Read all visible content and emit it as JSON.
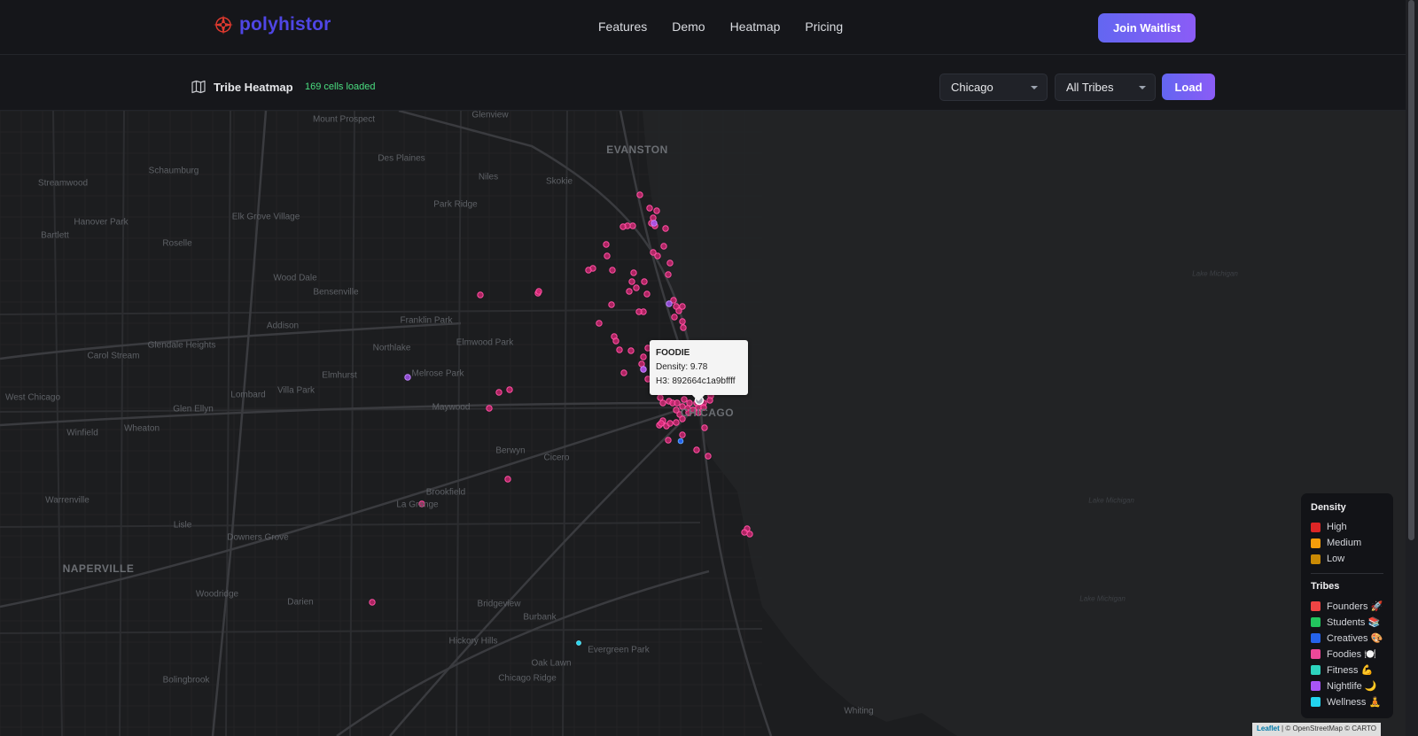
{
  "brand": {
    "name": "polyhistor"
  },
  "nav": {
    "links": [
      "Features",
      "Demo",
      "Heatmap",
      "Pricing"
    ],
    "cta": "Join Waitlist"
  },
  "toolbar": {
    "title": "Tribe Heatmap",
    "status": "169 cells loaded",
    "city_select": "Chicago",
    "tribe_select": "All Tribes",
    "load_button": "Load"
  },
  "map": {
    "place_labels": [
      "Mount Prospect",
      "Glenview",
      "EVANSTON",
      "Schaumburg",
      "Des Plaines",
      "Niles",
      "Skokie",
      "Streamwood",
      "Elk Grove Village",
      "Park Ridge",
      "Hanover Park",
      "Bartlett",
      "Roselle",
      "Wood Dale",
      "Bensenville",
      "Franklin Park",
      "Addison",
      "Northlake",
      "Elmwood Park",
      "Glendale Heights",
      "Carol Stream",
      "Elmhurst",
      "Melrose Park",
      "Villa Park",
      "Lombard",
      "West Chicago",
      "Glen Ellyn",
      "Maywood",
      "CHICAGO",
      "Winfield",
      "Wheaton",
      "Berwyn",
      "Cicero",
      "Warrenville",
      "Brookfield",
      "La Grange",
      "Lisle",
      "Downers Grove",
      "NAPERVILLE",
      "Woodridge",
      "Darien",
      "Bridgeview",
      "Burbank",
      "Hickory Hills",
      "Evergreen Park",
      "Oak Lawn",
      "Chicago Ridge",
      "Bolingbrook",
      "Whiting",
      "Lake Michigan"
    ]
  },
  "tooltip": {
    "title": "FOODIE",
    "density": "Density: 9.78",
    "h3": "H3: 892664c1a9bffff"
  },
  "legend": {
    "density_title": "Density",
    "density": [
      {
        "label": "High",
        "color": "#dc2626"
      },
      {
        "label": "Medium",
        "color": "#f59e0b"
      },
      {
        "label": "Low",
        "color": "#ca8a04"
      }
    ],
    "tribes_title": "Tribes",
    "tribes": [
      {
        "label": "Founders 🚀",
        "color": "#ef4444"
      },
      {
        "label": "Students 📚",
        "color": "#22c55e"
      },
      {
        "label": "Creatives 🎨",
        "color": "#2563eb"
      },
      {
        "label": "Foodies 🍽️",
        "color": "#ec4899"
      },
      {
        "label": "Fitness 💪",
        "color": "#2dd4bf"
      },
      {
        "label": "Nightlife 🌙",
        "color": "#a855f7"
      },
      {
        "label": "Wellness 🧘",
        "color": "#22d3ee"
      }
    ]
  },
  "attribution": {
    "leaflet": "Leaflet",
    "rest": " | © OpenStreetMap © CARTO"
  },
  "colors": {
    "accent": "#6366f1",
    "accent2": "#8b5cf6",
    "status": "#4ade80",
    "foodie": "#ec4899"
  }
}
